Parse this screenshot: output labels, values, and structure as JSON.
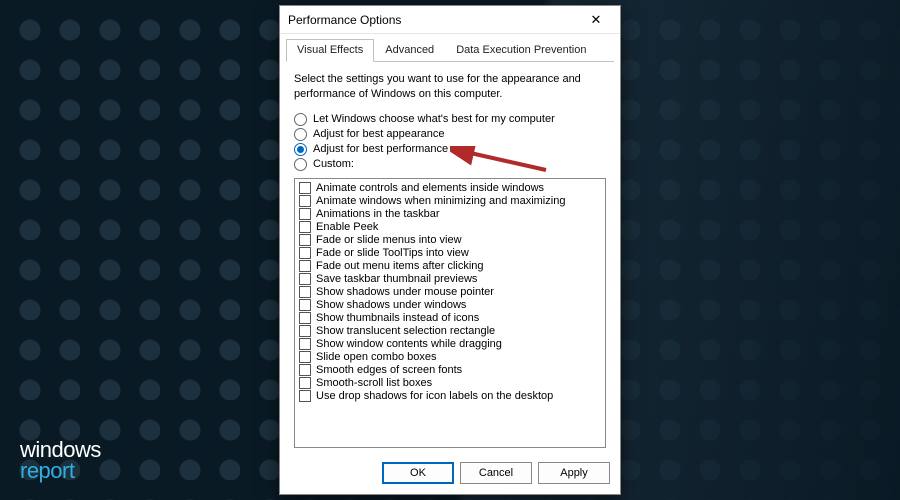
{
  "window": {
    "title": "Performance Options",
    "close_label": "✕"
  },
  "tabs": [
    {
      "label": "Visual Effects",
      "active": true
    },
    {
      "label": "Advanced",
      "active": false
    },
    {
      "label": "Data Execution Prevention",
      "active": false
    }
  ],
  "intro": "Select the settings you want to use for the appearance and performance of Windows on this computer.",
  "radios": [
    {
      "label": "Let Windows choose what's best for my computer",
      "selected": false
    },
    {
      "label": "Adjust for best appearance",
      "selected": false
    },
    {
      "label": "Adjust for best performance",
      "selected": true
    },
    {
      "label": "Custom:",
      "selected": false
    }
  ],
  "effects": [
    "Animate controls and elements inside windows",
    "Animate windows when minimizing and maximizing",
    "Animations in the taskbar",
    "Enable Peek",
    "Fade or slide menus into view",
    "Fade or slide ToolTips into view",
    "Fade out menu items after clicking",
    "Save taskbar thumbnail previews",
    "Show shadows under mouse pointer",
    "Show shadows under windows",
    "Show thumbnails instead of icons",
    "Show translucent selection rectangle",
    "Show window contents while dragging",
    "Slide open combo boxes",
    "Smooth edges of screen fonts",
    "Smooth-scroll list boxes",
    "Use drop shadows for icon labels on the desktop"
  ],
  "buttons": {
    "ok": "OK",
    "cancel": "Cancel",
    "apply": "Apply"
  },
  "watermark": {
    "line1": "windows",
    "line2": "report"
  },
  "annotation": {
    "arrow_color": "#b02a2a"
  }
}
